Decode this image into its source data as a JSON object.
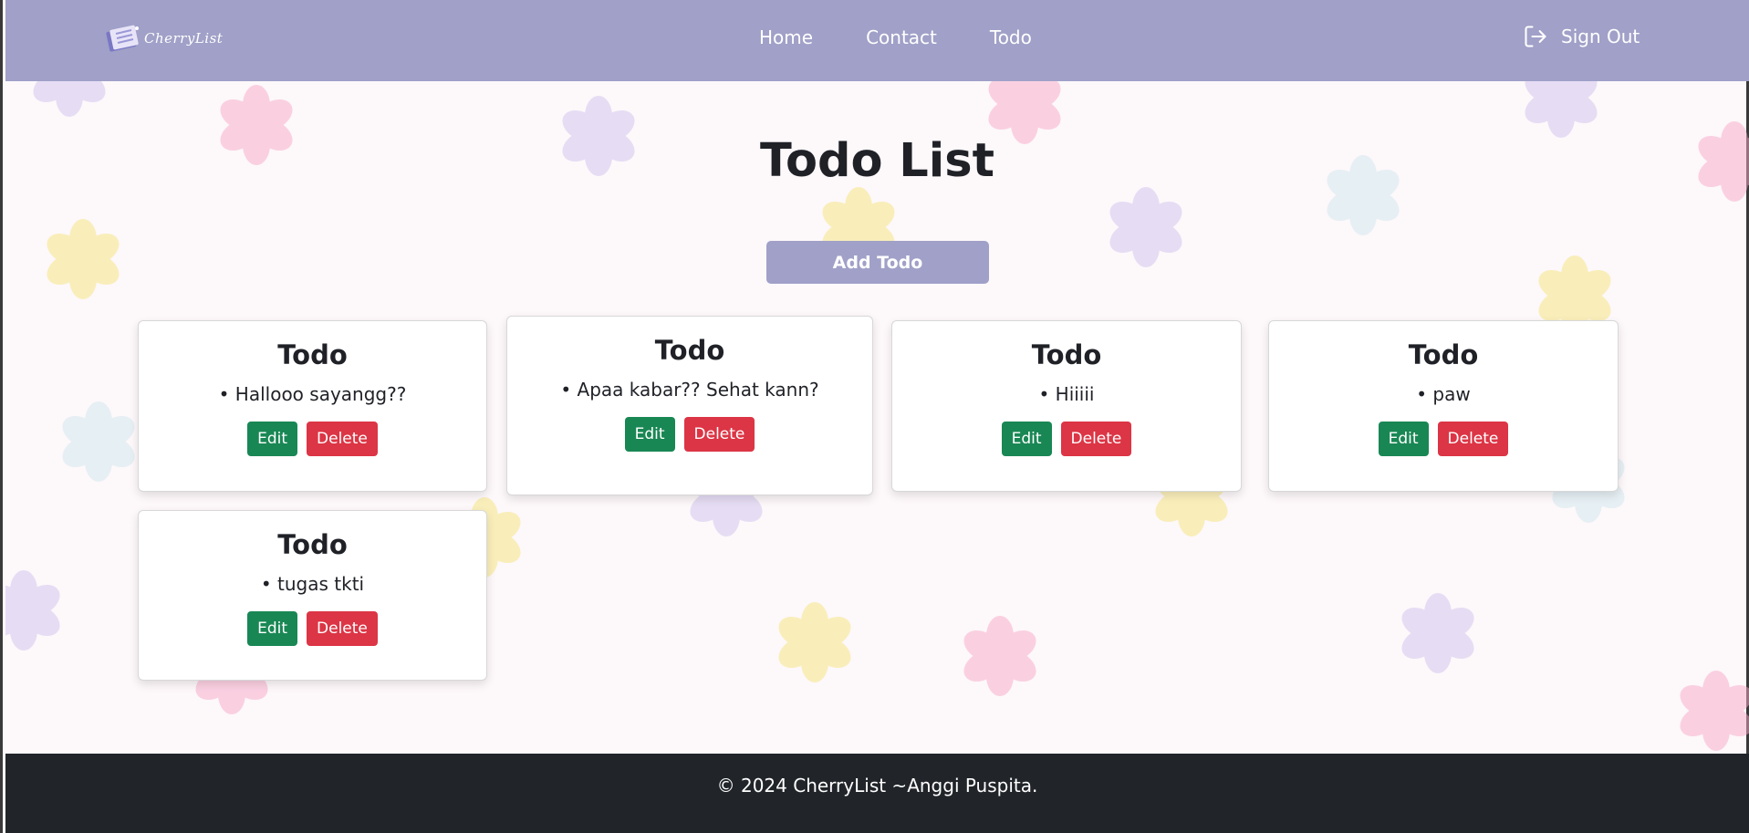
{
  "brand": {
    "logo_text": "CherryList"
  },
  "nav": {
    "links": [
      "Home",
      "Contact",
      "Todo"
    ],
    "signout_label": "Sign Out"
  },
  "page": {
    "title": "Todo List",
    "add_button": "Add Todo"
  },
  "todos": [
    {
      "title": "Todo",
      "text": "• Hallooo sayangg??",
      "edit": "Edit",
      "delete": "Delete"
    },
    {
      "title": "Todo",
      "text": "• Apaa kabar?? Sehat kann?",
      "edit": "Edit",
      "delete": "Delete"
    },
    {
      "title": "Todo",
      "text": "• Hiiiii",
      "edit": "Edit",
      "delete": "Delete"
    },
    {
      "title": "Todo",
      "text": "• paw",
      "edit": "Edit",
      "delete": "Delete"
    },
    {
      "title": "Todo",
      "text": "• tugas tkti",
      "edit": "Edit",
      "delete": "Delete"
    }
  ],
  "footer": {
    "text": "© 2024 CherryList ~Anggi Puspita."
  },
  "colors": {
    "navbar": "#a0a0c8",
    "edit": "#198754",
    "delete": "#dc3545",
    "footer": "#212529"
  }
}
